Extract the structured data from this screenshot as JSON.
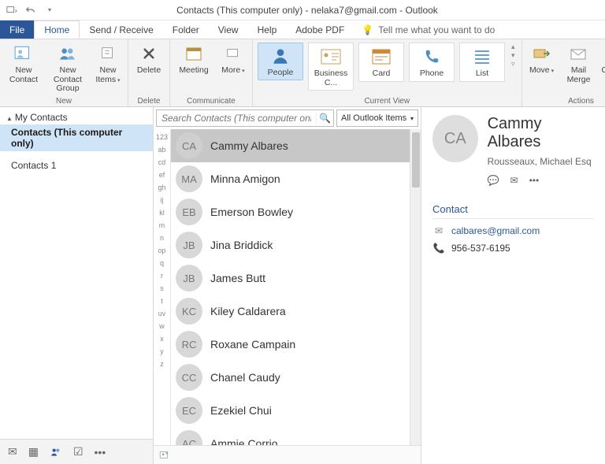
{
  "window": {
    "title": "Contacts (This computer only) - nelaka7@gmail.com - Outlook"
  },
  "tabs": {
    "file": "File",
    "home": "Home",
    "sendReceive": "Send / Receive",
    "folder": "Folder",
    "view": "View",
    "help": "Help",
    "adobe": "Adobe PDF",
    "tell": "Tell me what you want to do"
  },
  "ribbon": {
    "new": {
      "label": "New",
      "newContact": "New Contact",
      "newGroup": "New Contact Group",
      "newItems": "New Items"
    },
    "delete": {
      "label": "Delete",
      "button": "Delete"
    },
    "communicate": {
      "label": "Communicate",
      "meeting": "Meeting",
      "more": "More"
    },
    "currentView": {
      "label": "Current View",
      "people": "People",
      "business": "Business C...",
      "card": "Card",
      "phone": "Phone",
      "list": "List"
    },
    "actions": {
      "label": "Actions",
      "move": "Move",
      "mailMerge": "Mail Merge",
      "onenote": "OneNote"
    }
  },
  "nav": {
    "header": "My Contacts",
    "folder1": "Contacts (This computer only)",
    "folder2": "Contacts 1"
  },
  "search": {
    "placeholder": "Search Contacts (This computer only)",
    "scope": "All Outlook Items"
  },
  "alpha": [
    "123",
    "ab",
    "cd",
    "ef",
    "gh",
    "ij",
    "kl",
    "m",
    "n",
    "op",
    "q",
    "r",
    "s",
    "t",
    "uv",
    "w",
    "x",
    "y",
    "z"
  ],
  "contacts": [
    {
      "initials": "CA",
      "name": "Cammy Albares",
      "selected": true
    },
    {
      "initials": "MA",
      "name": "Minna Amigon"
    },
    {
      "initials": "EB",
      "name": "Emerson Bowley"
    },
    {
      "initials": "JB",
      "name": "Jina Briddick"
    },
    {
      "initials": "JB",
      "name": "James Butt"
    },
    {
      "initials": "KC",
      "name": "Kiley Caldarera"
    },
    {
      "initials": "RC",
      "name": "Roxane Campain"
    },
    {
      "initials": "CC",
      "name": "Chanel Caudy"
    },
    {
      "initials": "EC",
      "name": "Ezekiel Chui"
    },
    {
      "initials": "AC",
      "name": "Ammie Corrio"
    }
  ],
  "reading": {
    "initials": "CA",
    "name": "Cammy Albares",
    "subtitle": "Rousseaux, Michael Esq",
    "sectionTitle": "Contact",
    "email": "calbares@gmail.com",
    "phone": "956-537-6195"
  }
}
